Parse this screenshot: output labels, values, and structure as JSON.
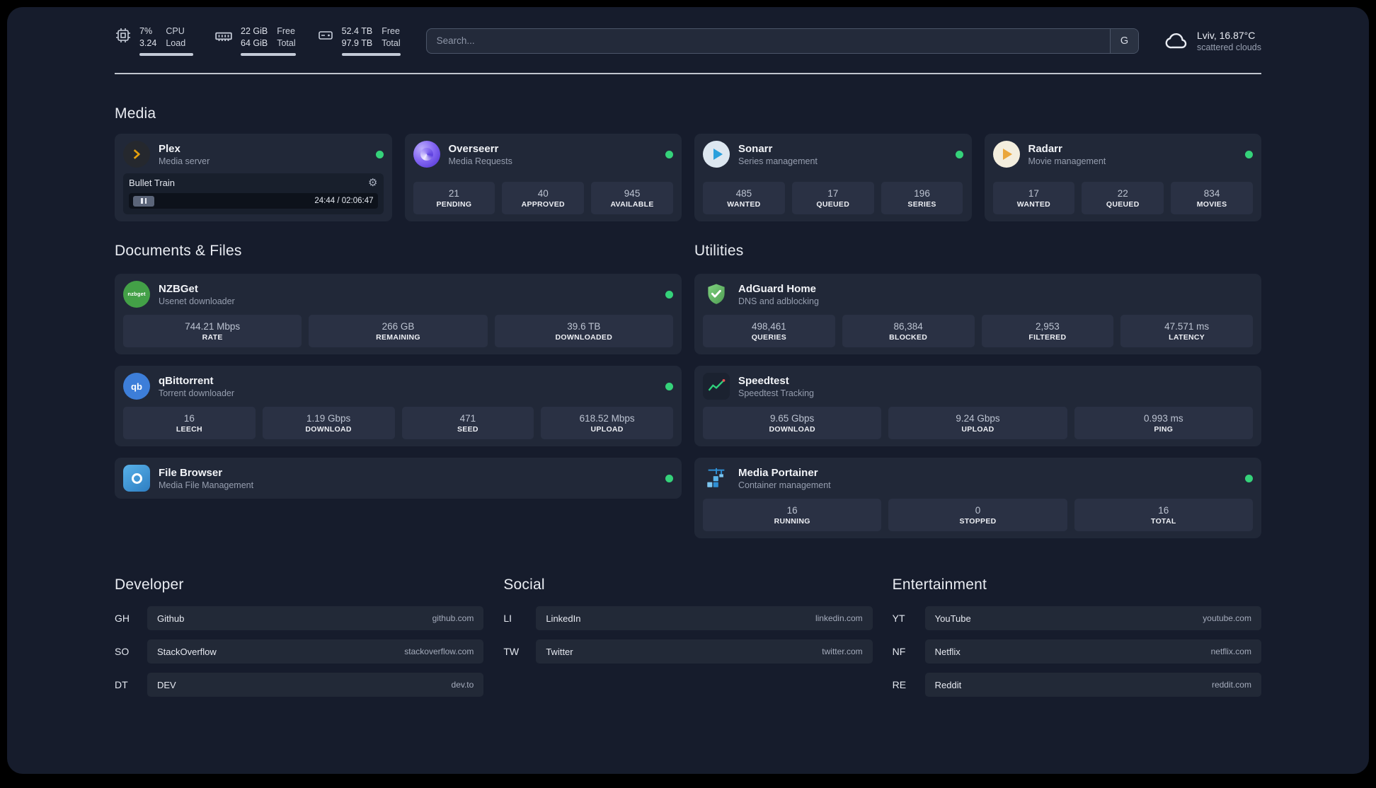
{
  "icons": {
    "gear": "⚙"
  },
  "topbar": {
    "cpu": {
      "value_top": "7%",
      "value_bottom": "3.24",
      "label_top": "CPU",
      "label_bottom": "Load"
    },
    "memory": {
      "value_top": "22 GiB",
      "value_bottom": "64 GiB",
      "label_top": "Free",
      "label_bottom": "Total"
    },
    "disk": {
      "value_top": "52.4 TB",
      "value_bottom": "97.9 TB",
      "label_top": "Free",
      "label_bottom": "Total"
    },
    "search": {
      "placeholder": "Search...",
      "engine_label": "G"
    },
    "weather": {
      "location": "Lviv, 16.87°C",
      "condition": "scattered clouds"
    }
  },
  "groups": {
    "media": {
      "title": "Media",
      "plex": {
        "name": "Plex",
        "desc": "Media server",
        "now_playing": "Bullet Train",
        "time": "24:44 / 02:06:47"
      },
      "overseerr": {
        "name": "Overseerr",
        "desc": "Media Requests",
        "stats": [
          {
            "value": "21",
            "label": "PENDING"
          },
          {
            "value": "40",
            "label": "APPROVED"
          },
          {
            "value": "945",
            "label": "AVAILABLE"
          }
        ]
      },
      "sonarr": {
        "name": "Sonarr",
        "desc": "Series management",
        "stats": [
          {
            "value": "485",
            "label": "WANTED"
          },
          {
            "value": "17",
            "label": "QUEUED"
          },
          {
            "value": "196",
            "label": "SERIES"
          }
        ]
      },
      "radarr": {
        "name": "Radarr",
        "desc": "Movie management",
        "stats": [
          {
            "value": "17",
            "label": "WANTED"
          },
          {
            "value": "22",
            "label": "QUEUED"
          },
          {
            "value": "834",
            "label": "MOVIES"
          }
        ]
      }
    },
    "documents": {
      "title": "Documents & Files",
      "nzbget": {
        "name": "NZBGet",
        "desc": "Usenet downloader",
        "icon_text": "nzbget",
        "stats": [
          {
            "value": "744.21 Mbps",
            "label": "RATE"
          },
          {
            "value": "266 GB",
            "label": "REMAINING"
          },
          {
            "value": "39.6 TB",
            "label": "DOWNLOADED"
          }
        ]
      },
      "qbittorrent": {
        "name": "qBittorrent",
        "desc": "Torrent downloader",
        "icon_text": "qb",
        "stats": [
          {
            "value": "16",
            "label": "LEECH"
          },
          {
            "value": "1.19 Gbps",
            "label": "DOWNLOAD"
          },
          {
            "value": "471",
            "label": "SEED"
          },
          {
            "value": "618.52 Mbps",
            "label": "UPLOAD"
          }
        ]
      },
      "filebrowser": {
        "name": "File Browser",
        "desc": "Media File Management"
      }
    },
    "utilities": {
      "title": "Utilities",
      "adguard": {
        "name": "AdGuard Home",
        "desc": "DNS and adblocking",
        "stats": [
          {
            "value": "498,461",
            "label": "QUERIES"
          },
          {
            "value": "86,384",
            "label": "BLOCKED"
          },
          {
            "value": "2,953",
            "label": "FILTERED"
          },
          {
            "value": "47.571 ms",
            "label": "LATENCY"
          }
        ]
      },
      "speedtest": {
        "name": "Speedtest",
        "desc": "Speedtest Tracking",
        "stats": [
          {
            "value": "9.65 Gbps",
            "label": "DOWNLOAD"
          },
          {
            "value": "9.24 Gbps",
            "label": "UPLOAD"
          },
          {
            "value": "0.993 ms",
            "label": "PING"
          }
        ]
      },
      "portainer": {
        "name": "Media Portainer",
        "desc": "Container management",
        "stats": [
          {
            "value": "16",
            "label": "RUNNING"
          },
          {
            "value": "0",
            "label": "STOPPED"
          },
          {
            "value": "16",
            "label": "TOTAL"
          }
        ]
      }
    }
  },
  "bookmarks": {
    "developer": {
      "title": "Developer",
      "items": [
        {
          "abbr": "GH",
          "name": "Github",
          "domain": "github.com"
        },
        {
          "abbr": "SO",
          "name": "StackOverflow",
          "domain": "stackoverflow.com"
        },
        {
          "abbr": "DT",
          "name": "DEV",
          "domain": "dev.to"
        }
      ]
    },
    "social": {
      "title": "Social",
      "items": [
        {
          "abbr": "LI",
          "name": "LinkedIn",
          "domain": "linkedin.com"
        },
        {
          "abbr": "TW",
          "name": "Twitter",
          "domain": "twitter.com"
        }
      ]
    },
    "entertainment": {
      "title": "Entertainment",
      "items": [
        {
          "abbr": "YT",
          "name": "YouTube",
          "domain": "youtube.com"
        },
        {
          "abbr": "NF",
          "name": "Netflix",
          "domain": "netflix.com"
        },
        {
          "abbr": "RE",
          "name": "Reddit",
          "domain": "reddit.com"
        }
      ]
    }
  }
}
